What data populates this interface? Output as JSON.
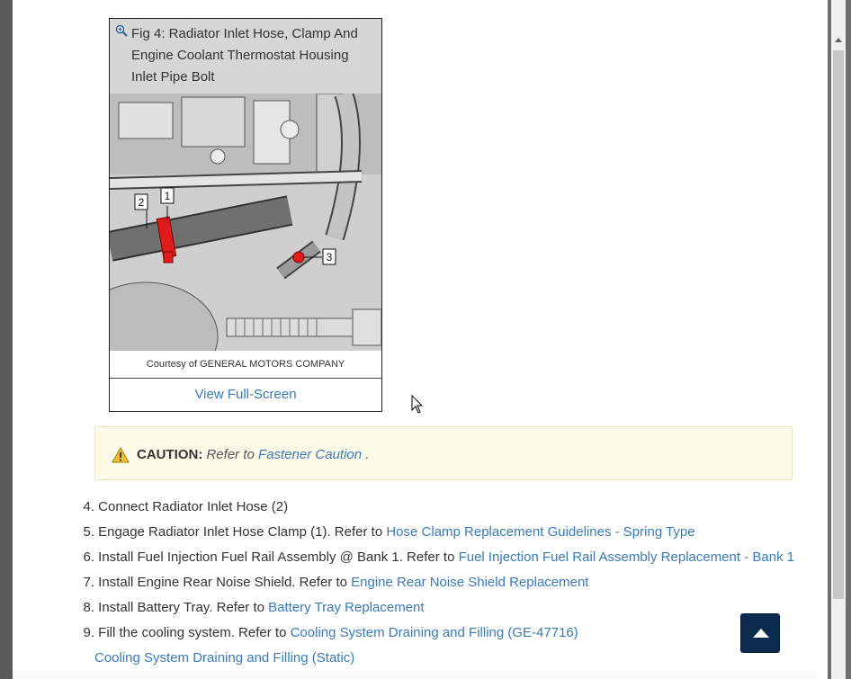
{
  "figure": {
    "caption": "Fig 4: Radiator Inlet Hose, Clamp And Engine Coolant Thermostat Housing Inlet Pipe Bolt",
    "callouts": [
      "1",
      "2",
      "3"
    ],
    "credit": "Courtesy of GENERAL MOTORS COMPANY",
    "fullscreen_label": "View Full-Screen"
  },
  "caution": {
    "label": "CAUTION:",
    "text": "Refer to",
    "link": "Fastener Caution",
    "trail": "."
  },
  "steps": [
    {
      "num": "4.",
      "text": "Connect Radiator Inlet Hose (2)",
      "link": ""
    },
    {
      "num": "5.",
      "text": "Engage Radiator Inlet Hose Clamp (1). Refer to",
      "link": "Hose Clamp Replacement Guidelines - Spring Type"
    },
    {
      "num": "6.",
      "text": "Install Fuel Injection Fuel Rail Assembly @ Bank 1. Refer to",
      "link": "Fuel Injection Fuel Rail Assembly Replacement - Bank 1"
    },
    {
      "num": "7.",
      "text": "Install Engine Rear Noise Shield. Refer to",
      "link": "Engine Rear Noise Shield Replacement"
    },
    {
      "num": "8.",
      "text": "Install Battery Tray. Refer to",
      "link": "Battery Tray Replacement"
    },
    {
      "num": "9.",
      "text": "Fill the cooling system. Refer to",
      "link": "Cooling System Draining and Filling (GE-47716)"
    }
  ],
  "step9_extra_link": "Cooling System Draining and Filling (Static)",
  "colors": {
    "link": "#3a7ab8",
    "caution_bg": "#fefbe8",
    "top_button": "#0c2a4d",
    "highlight_red": "#e01b1b"
  },
  "icons": {
    "zoom": "magnifier-plus-icon",
    "caution": "warning-triangle-icon",
    "back_to_top": "arrow-up-icon"
  }
}
